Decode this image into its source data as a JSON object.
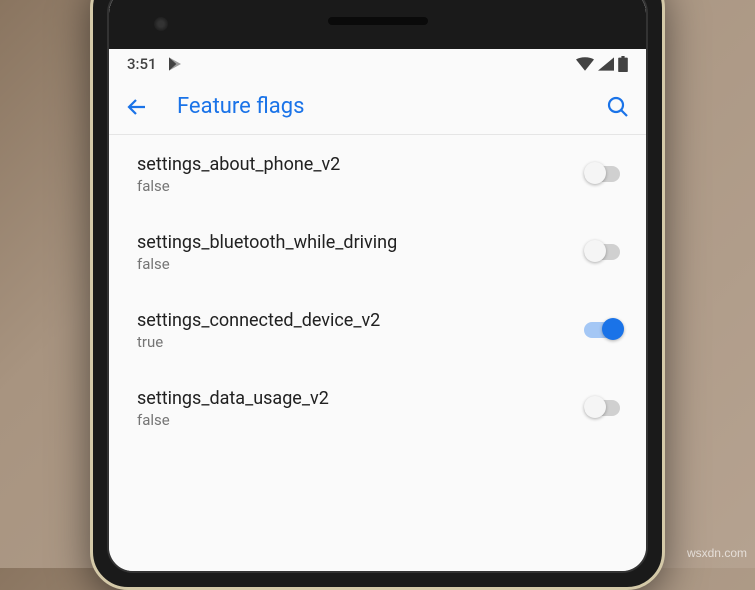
{
  "status_bar": {
    "time": "3:51",
    "wifi": true,
    "signal": true,
    "battery": true
  },
  "app_bar": {
    "title": "Feature flags"
  },
  "settings": [
    {
      "name": "settings_about_phone_v2",
      "value": "false",
      "enabled": false
    },
    {
      "name": "settings_bluetooth_while_driving",
      "value": "false",
      "enabled": false
    },
    {
      "name": "settings_connected_device_v2",
      "value": "true",
      "enabled": true
    },
    {
      "name": "settings_data_usage_v2",
      "value": "false",
      "enabled": false
    }
  ],
  "watermark": "wsxdn.com"
}
